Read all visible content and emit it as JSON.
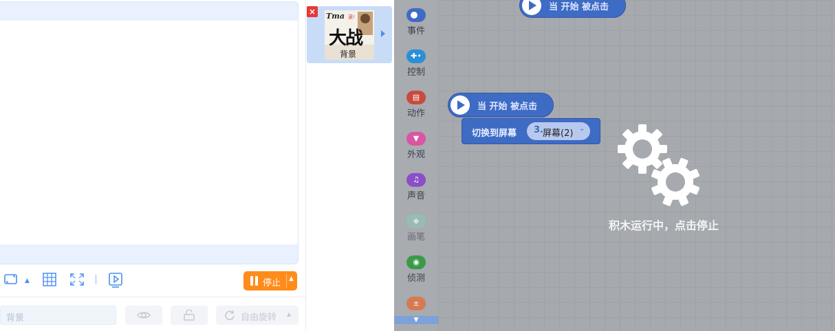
{
  "toolbar": {
    "stop_label": "停止",
    "sprite_name_placeholder": "背景",
    "rotation_label": "自由旋转"
  },
  "sprite_panel": {
    "sprite_label": "背景",
    "thumb_text": "大战"
  },
  "categories": [
    {
      "label": "事件",
      "color": "#3e6bc4"
    },
    {
      "label": "控制",
      "color": "#2b8fd6"
    },
    {
      "label": "动作",
      "color": "#c94a3e"
    },
    {
      "label": "外观",
      "color": "#d955a5"
    },
    {
      "label": "声音",
      "color": "#8a4fc9"
    },
    {
      "label": "画笔",
      "color": "#8ec8b4"
    },
    {
      "label": "侦测",
      "color": "#3a9a4a"
    },
    {
      "label": "运算",
      "color": "#d67a52"
    }
  ],
  "workspace": {
    "hat_top_label": "当 开始 被点击",
    "hat_label": "当 开始 被点击",
    "switch_label": "切换到屏幕",
    "screen_number": "3.",
    "screen_value": "屏幕(2)",
    "running_text": "积木运行中，点击停止"
  },
  "colors": {
    "accent": "#4a8ef0",
    "stop": "#ff8c1a",
    "block": "#3e6bc4"
  }
}
